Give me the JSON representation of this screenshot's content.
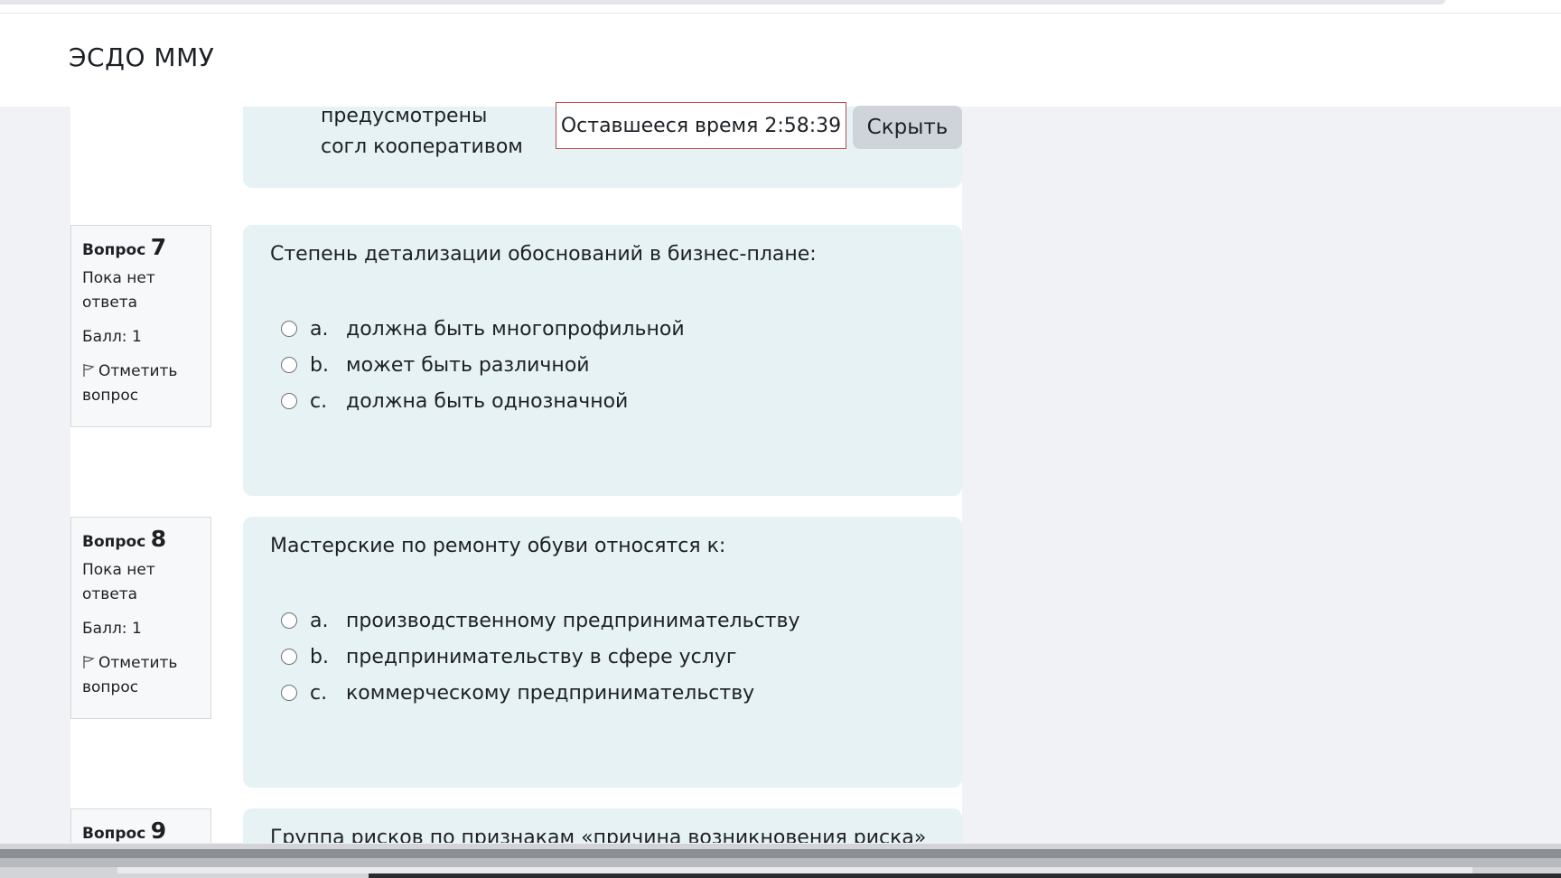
{
  "site": {
    "brand": "ЭСДО ММУ"
  },
  "timer": {
    "label": "Оставшееся время 2:58:39",
    "hide_label": "Скрыть"
  },
  "previous_question": {
    "partial_answer_text": "предусмотрены согл кооперативом"
  },
  "questions": [
    {
      "prefix": "Вопрос",
      "number": "7",
      "state": "Пока нет ответа",
      "grade": "Балл: 1",
      "flag": "Отметить вопрос",
      "text": "Степень детализации обоснований в бизнес-плане:",
      "answers": [
        {
          "letter": "a.",
          "text": "должна быть многопрофильной"
        },
        {
          "letter": "b.",
          "text": "может быть различной"
        },
        {
          "letter": "c.",
          "text": "должна быть однозначной"
        }
      ]
    },
    {
      "prefix": "Вопрос",
      "number": "8",
      "state": "Пока нет ответа",
      "grade": "Балл: 1",
      "flag": "Отметить вопрос",
      "text": "Мастерские по ремонту обуви относятся к:",
      "answers": [
        {
          "letter": "a.",
          "text": "производственному предпринимательству"
        },
        {
          "letter": "b.",
          "text": "предпринимательству в сфере услуг"
        },
        {
          "letter": "c.",
          "text": "коммерческому предпринимательству"
        }
      ]
    },
    {
      "prefix": "Вопрос",
      "number": "9",
      "text": "Группа рисков по признакам «причина возникновения риска»"
    }
  ],
  "colors": {
    "question_bg": "#e7f2f5",
    "page_bg": "#f1f2f5",
    "timer_border": "#b64b4b",
    "button_bg": "#ced4da"
  }
}
